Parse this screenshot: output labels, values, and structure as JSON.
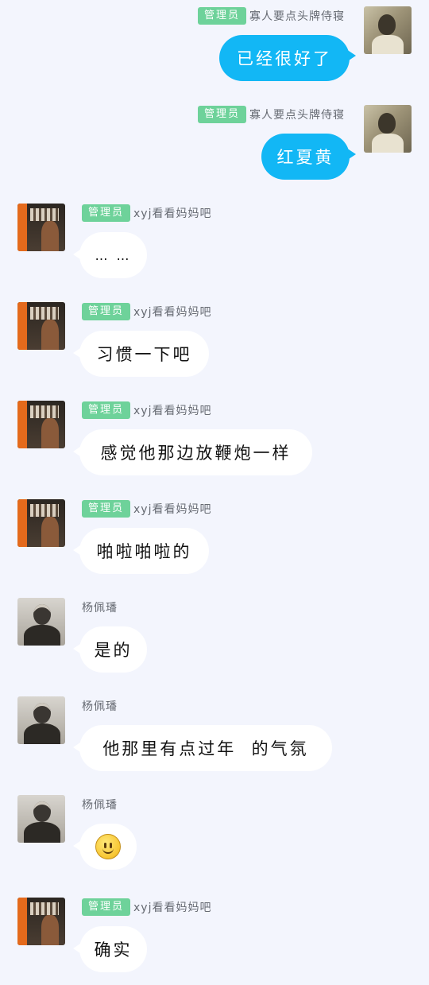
{
  "messages": [
    {
      "side": "right",
      "avatar": "me",
      "badge": "管理员",
      "sender": "寡人要点头牌侍寝",
      "text": "已经很好了"
    },
    {
      "side": "right",
      "avatar": "me",
      "badge": "管理员",
      "sender": "寡人要点头牌侍寝",
      "text": "红夏黄"
    },
    {
      "side": "left",
      "avatar": "xyj",
      "badge": "管理员",
      "sender": "xyj看看妈妈吧",
      "text": "…  …"
    },
    {
      "side": "left",
      "avatar": "xyj",
      "badge": "管理员",
      "sender": "xyj看看妈妈吧",
      "text": "习惯一下吧"
    },
    {
      "side": "left",
      "avatar": "xyj",
      "badge": "管理员",
      "sender": "xyj看看妈妈吧",
      "text": "感觉他那边放鞭炮一样"
    },
    {
      "side": "left",
      "avatar": "xyj",
      "badge": "管理员",
      "sender": "xyj看看妈妈吧",
      "text": "啪啦啪啦的"
    },
    {
      "side": "left",
      "avatar": "ypl",
      "sender": "杨佩璠",
      "text": "是的"
    },
    {
      "side": "left",
      "avatar": "ypl",
      "sender": "杨佩璠",
      "text": "他那里有点过年  的气氛"
    },
    {
      "side": "left",
      "avatar": "ypl",
      "sender": "杨佩璠",
      "emoji": "smile-emoji"
    },
    {
      "side": "left",
      "avatar": "xyj",
      "badge": "管理员",
      "sender": "xyj看看妈妈吧",
      "text": "确实"
    }
  ]
}
